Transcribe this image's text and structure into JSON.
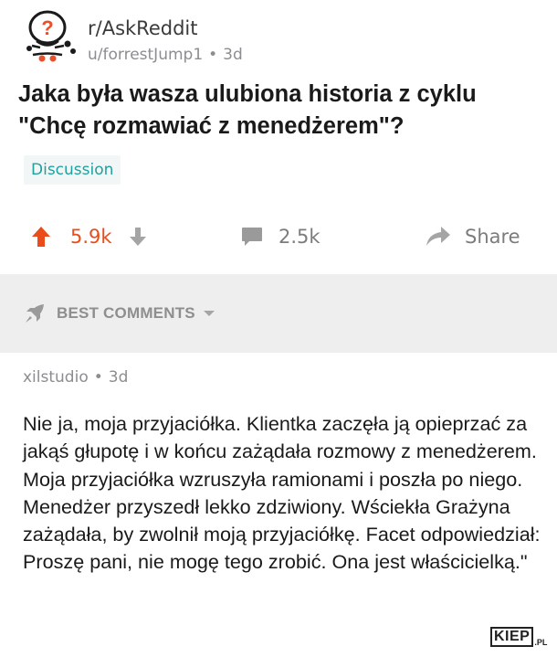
{
  "post": {
    "subreddit": "r/AskReddit",
    "author": "u/forrestJump1",
    "age": "3d",
    "title": "Jaka była wasza ulubiona historia z cyklu \"Chcę rozmawiać z menedżerem\"?",
    "flair": "Discussion",
    "score": "5.9k",
    "comment_count": "2.5k",
    "share_label": "Share"
  },
  "sort": {
    "label": "BEST COMMENTS"
  },
  "comment": {
    "author": "xilstudio",
    "age": "3d",
    "body": "Nie ja, moja przyjaciółka. Klientka zaczęła ją opieprzać za jakąś głupotę i w końcu zażądała rozmowy z menedżerem. Moja przyjaciółka wzruszyła ramionami i poszła po niego. Menedżer przyszedł lekko zdziwiony. Wściekła Grażyna zażądała, by zwolnił moją przyjaciółkę. Facet odpowiedział: Proszę pani, nie mogę tego zrobić. Ona jest właścicielką.\""
  },
  "watermark": {
    "main": "KIEP",
    "tld": ".PL"
  },
  "colors": {
    "upvote_accent": "#ea4c1a",
    "flair_text": "#1fa1a0",
    "muted_text": "#8b8d90",
    "sort_band_bg": "#eeeeee"
  },
  "icons": {
    "subreddit_avatar": "askreddit-snoo-icon",
    "upvote": "arrow-up-icon",
    "downvote": "arrow-down-icon",
    "comments": "speech-bubble-icon",
    "share": "share-arrow-icon",
    "sort": "rocket-icon",
    "sort_dropdown": "caret-down-icon"
  }
}
